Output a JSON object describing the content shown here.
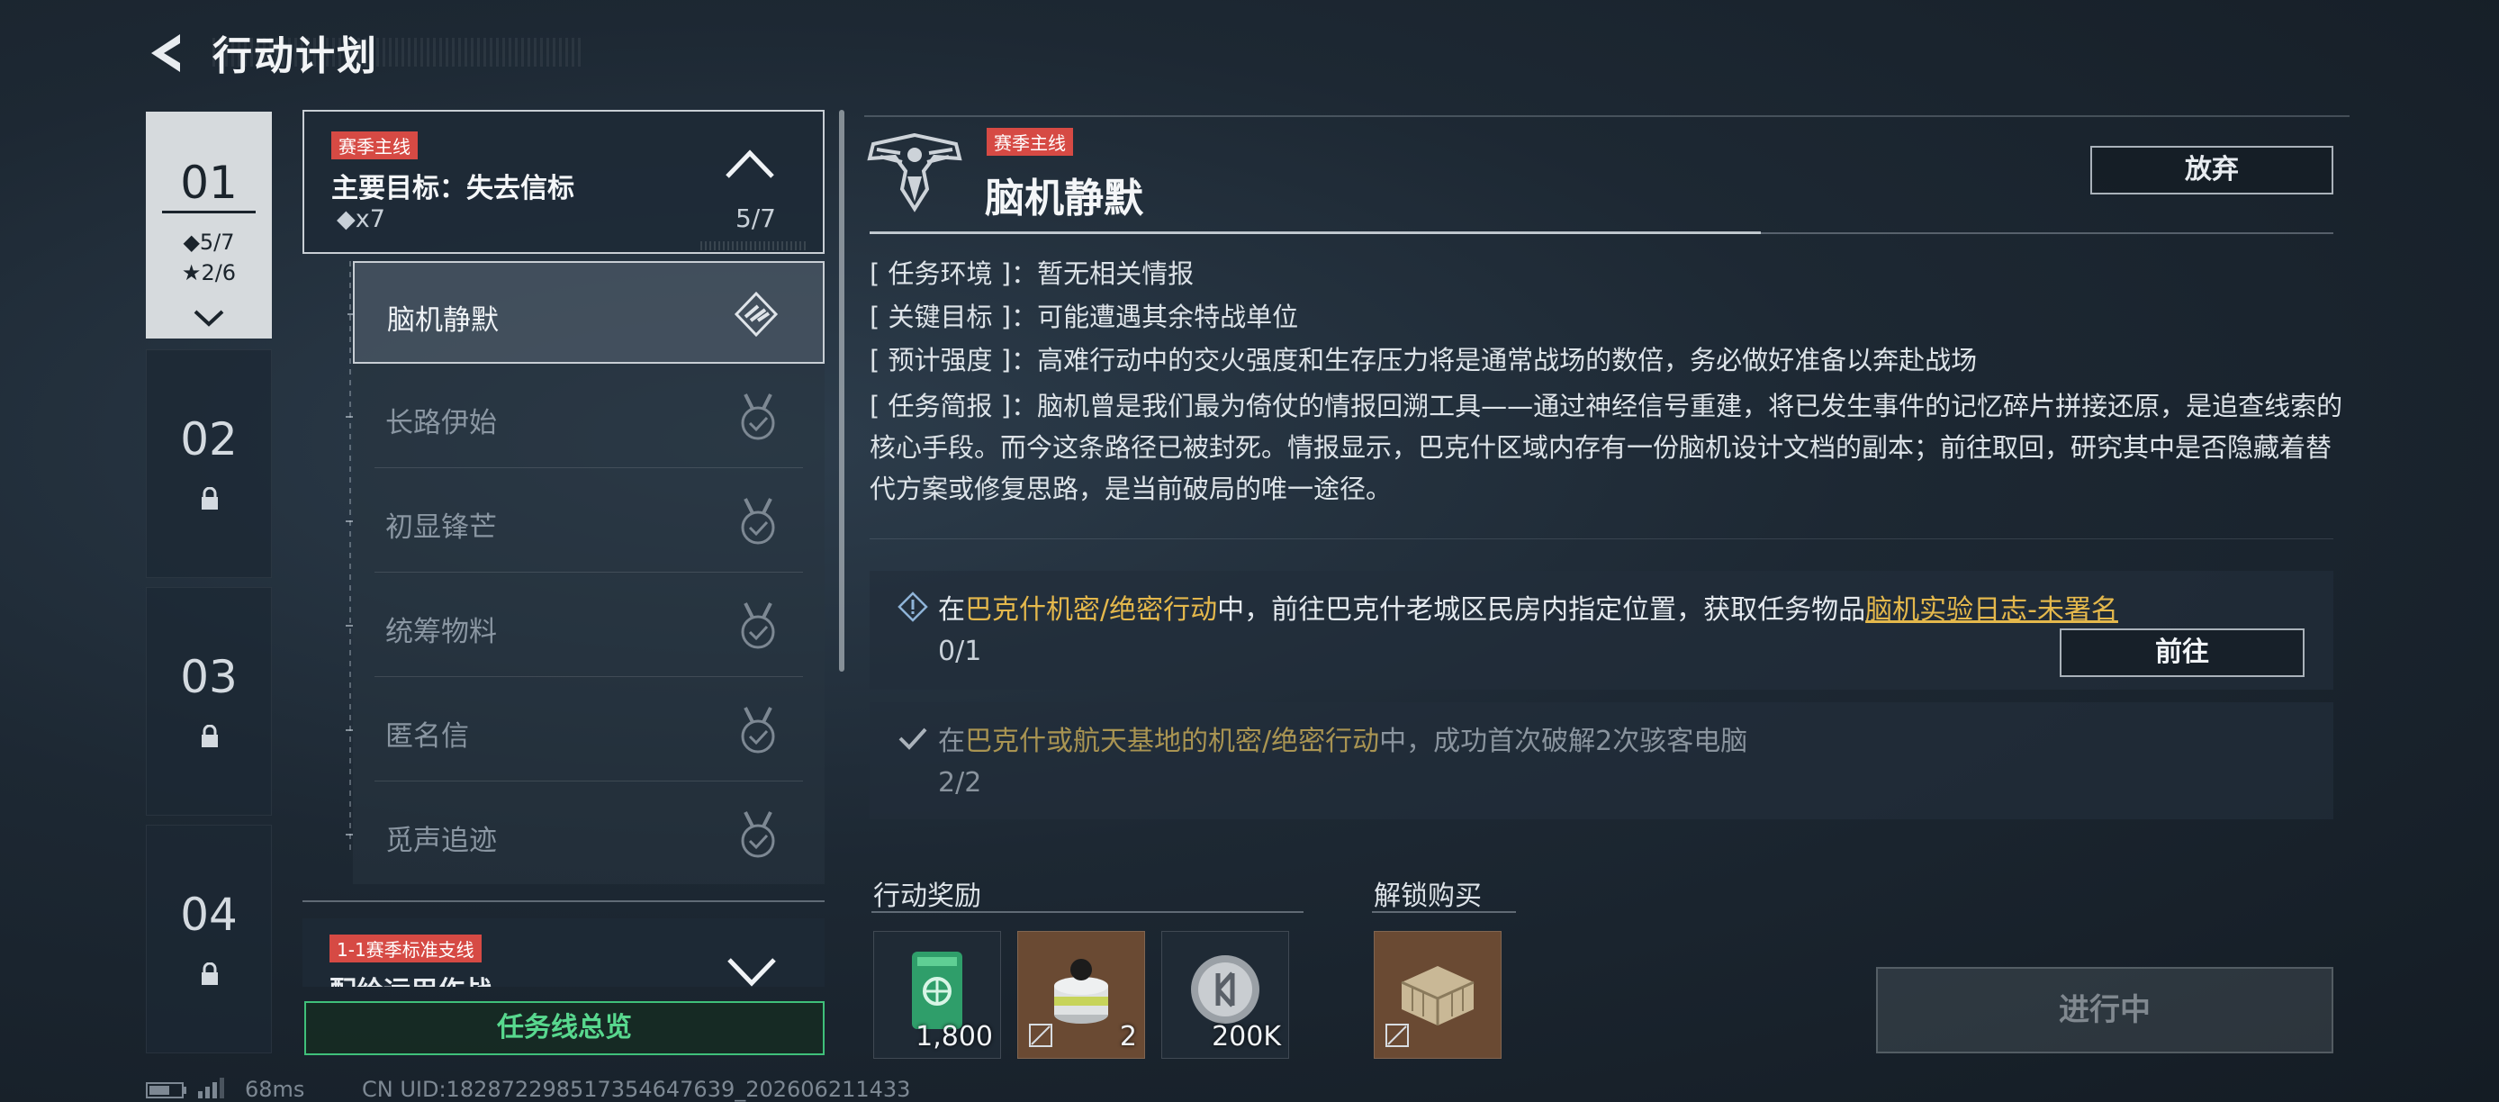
{
  "header": {
    "title": "行动计划"
  },
  "chapters": [
    {
      "num": "01",
      "gems": "◆5/7",
      "stars": "★2/6"
    },
    {
      "num": "02"
    },
    {
      "num": "03"
    },
    {
      "num": "04"
    }
  ],
  "mission_group": {
    "tag": "赛季主线",
    "title": "主要目标：失去信标",
    "gems": "◆x7",
    "progress": "5/7"
  },
  "missions": [
    {
      "label": "脑机静默",
      "active": true
    },
    {
      "label": "长路伊始"
    },
    {
      "label": "初显锋芒"
    },
    {
      "label": "统筹物料"
    },
    {
      "label": "匿名信"
    },
    {
      "label": "觅声追迹"
    }
  ],
  "side_group": {
    "tag": "1-1赛季标准支线",
    "title": "配给运用作战"
  },
  "overview_button": "任务线总览",
  "detail": {
    "tag": "赛季主线",
    "title": "脑机静默",
    "abandon": "放弃",
    "env_key": "[ 任务环境 ]",
    "env_val": "暂无相关情报",
    "target_key": "[ 关键目标 ]",
    "target_val": "可能遭遇其余特战单位",
    "strength_key": "[ 预计强度 ]",
    "strength_val": "高难行动中的交火强度和生存压力将是通常战场的数倍，务必做好准备以奔赴战场",
    "brief_key": "[ 任务简报 ]",
    "brief_val": "脑机曾是我们最为倚仗的情报回溯工具——通过神经信号重建，将已发生事件的记忆碎片拼接还原，是追查线索的核心手段。而今这条路径已被封死。情报显示，巴克什区域内存有一份脑机设计文档的副本；前往取回，研究其中是否隐藏着替代方案或修复思路，是当前破局的唯一途径。"
  },
  "objectives": [
    {
      "pre": "在",
      "hl1": "巴克什机密/绝密行动",
      "mid": "中，前往巴克什老城区民房内指定位置，获取任务物品",
      "hl2": "脑机实验日志-未署名",
      "count": "0/1",
      "button": "前往"
    },
    {
      "pre": "在",
      "hl1": "巴克什或航天基地的机密/绝密行动",
      "mid": "中，成功首次破解2次骇客电脑",
      "count": "2/2"
    }
  ],
  "rewards": {
    "label": "行动奖励",
    "items": [
      {
        "icon": "green-card-icon",
        "count": "1,800"
      },
      {
        "icon": "gas-filter-icon",
        "count": "2"
      },
      {
        "icon": "silver-coin-icon",
        "count": "200K"
      }
    ]
  },
  "unlock": {
    "label": "解锁购买",
    "items": [
      {
        "icon": "crate-icon"
      }
    ]
  },
  "status_button": "进行中",
  "status_bar": {
    "ping": "68ms",
    "uid": "CN UID:182872298517354647639_202606211433"
  },
  "colors": {
    "accent_green": "#58d88e",
    "tag_red": "#d64a44",
    "highlight_gold": "#e4b84c"
  }
}
